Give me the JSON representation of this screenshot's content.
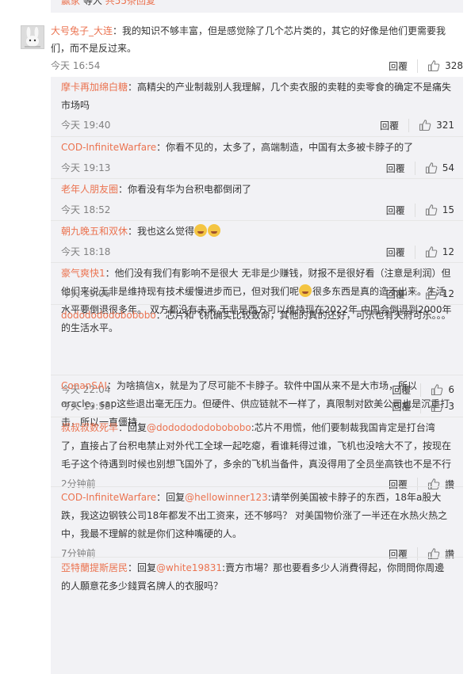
{
  "top_partial": {
    "text1": "赢家",
    "text2": "等人",
    "link": "共55条回复"
  },
  "main_comment": {
    "user": "大号兔子_大连",
    "text": "：我的知识不够丰富，但是感觉除了几个芯片类的，其它的好像是他们更需要我们，而不是反过来。",
    "time": "今天 16:54",
    "reply_label": "回覆",
    "likes": "328"
  },
  "replies": [
    {
      "user": "摩卡再加绵白糖",
      "pre": "：高精尖的产业制裁别人我理解，几个卖衣服的卖鞋的卖零食的确定不是痛失市场吗",
      "at": "",
      "post": "",
      "emoji_count": 0,
      "post_emoji": "",
      "time": "今天 19:40",
      "reply_label": "回覆",
      "likes": "321"
    },
    {
      "user": "COD-InfiniteWarfare",
      "pre": "：你看不见的，太多了，高端制造，中国有太多被卡脖子的了",
      "at": "",
      "post": "",
      "emoji_count": 0,
      "post_emoji": "",
      "time": "今天 19:13",
      "reply_label": "回覆",
      "likes": "54"
    },
    {
      "user": "老年人朋友圈",
      "pre": "：你看没有华为台积电都倒闭了",
      "at": "",
      "post": "",
      "emoji_count": 0,
      "post_emoji": "",
      "time": "今天 18:52",
      "reply_label": "回覆",
      "likes": "15"
    },
    {
      "user": "朝九晚五和双休",
      "pre": "：我也这么觉得",
      "at": "",
      "post": "",
      "emoji_count": 2,
      "post_emoji": "",
      "time": "今天 18:18",
      "reply_label": "回覆",
      "likes": "12"
    },
    {
      "user": "豪气爽快1",
      "pre": "：他们没有我们有影响不是很大 无非是少赚钱，财报不是很好看（注意是利润）但他们来说无非是维持现有技术缓慢进步而已，但对我们呢",
      "at": "",
      "post": "",
      "emoji_count": 1,
      "post_emoji": "很多东西是真的造不出来。生活水平要倒退很多年。 双方都没有未来 无非是西方可以维持现在2022年 中国会倒退到2000年的生活水平。",
      "time": "今天 19:06",
      "reply_label": "回覆",
      "likes": "12"
    },
    {
      "user": "dododododobobobo",
      "pre": "：芯片和飞机确实比较致命，其他的真的还好，可乐也有天府可乐。。。",
      "at": "",
      "post": "",
      "emoji_count": 0,
      "post_emoji": "",
      "time": "今天 22:04",
      "reply_label": "回覆",
      "likes": "6"
    },
    {
      "user": "ConanSAI",
      "pre": "：为啥搞信x，就是为了尽可能不卡脖子。软件中国从来不是大市场，所以oracle，sap这些退出毫无压力。但硬件、供应链就不一样了，真限制对欧美公司也是沉重打击，所以一直僵持",
      "at": "",
      "post": "",
      "emoji_count": 0,
      "post_emoji": "",
      "time": "今天 19:58",
      "reply_label": "回覆",
      "likes": "3"
    },
    {
      "user": "叔叔叔数死早",
      "pre": "：回复",
      "at": "@dododododobobobo",
      "post": ":芯片不用慌，他们要制裁我国肯定是打台湾了，直接占了台积电禁止对外代工全球一起吃瘪，看谁耗得过谁，飞机也没啥大不了，按现在毛子这个待遇到时候也别想飞国外了，多余的飞机当备件，真没得用了全员坐高铁也不是不行",
      "emoji_count": 0,
      "post_emoji": "",
      "time": "2分钟前",
      "reply_label": "回覆",
      "likes": "讚"
    },
    {
      "user": "COD-InfiniteWarfare",
      "pre": "：回复",
      "at": "@hellowinner123",
      "post": ":请举例美国被卡脖子的东西，18年a股大跌，我这边钢铁公司18年都发不出工资来，还不够吗？ 对美国物价涨了一半还在水热火热之中，我最不理解的就是你们这种嘴硬的人。",
      "emoji_count": 0,
      "post_emoji": "",
      "time": "7分钟前",
      "reply_label": "回覆",
      "likes": "讚"
    },
    {
      "user": "亞特蘭提斯居民",
      "pre": "：回复",
      "at": "@white19831",
      "post": ":賣方市場？那也要看多少人消費得起，你問問你周邊的人願意花多少錢買名牌人的衣服吗？",
      "emoji_count": 0,
      "post_emoji": "",
      "time": "",
      "reply_label": "",
      "likes": ""
    }
  ]
}
